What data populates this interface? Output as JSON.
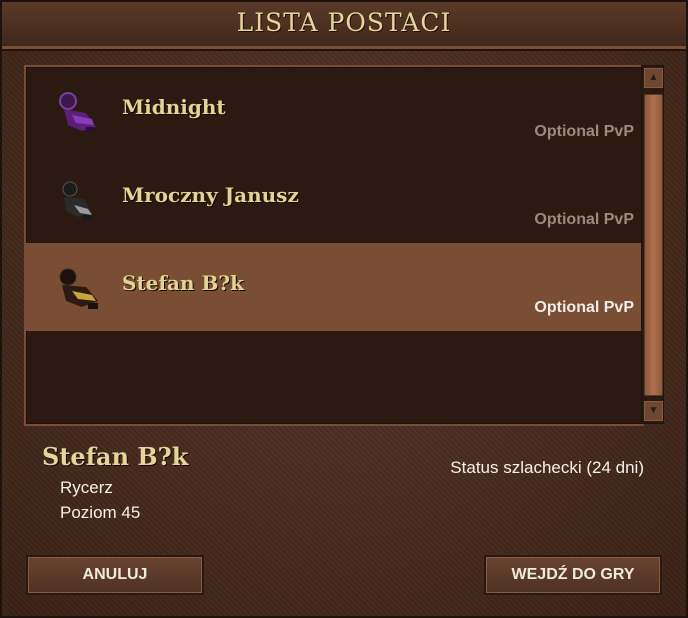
{
  "window": {
    "title": "LISTA POSTACI"
  },
  "characters": [
    {
      "name": "Midnight",
      "world": "Optional PvP",
      "selected": false
    },
    {
      "name": "Mroczny Janusz",
      "world": "Optional PvP",
      "selected": false
    },
    {
      "name": "Stefan B?k",
      "world": "Optional PvP",
      "selected": true
    }
  ],
  "details": {
    "name": "Stefan B?k",
    "vocation": "Rycerz",
    "level": "Poziom 45",
    "status": "Status szlachecki (24 dni)"
  },
  "buttons": {
    "cancel": "ANULUJ",
    "enter": "WEJDŹ DO GRY"
  },
  "colors": {
    "background": "#462a1d",
    "selected_row": "#7a4e34",
    "name_text": "#e4d393",
    "pvp_text": "#9a8b7e"
  }
}
